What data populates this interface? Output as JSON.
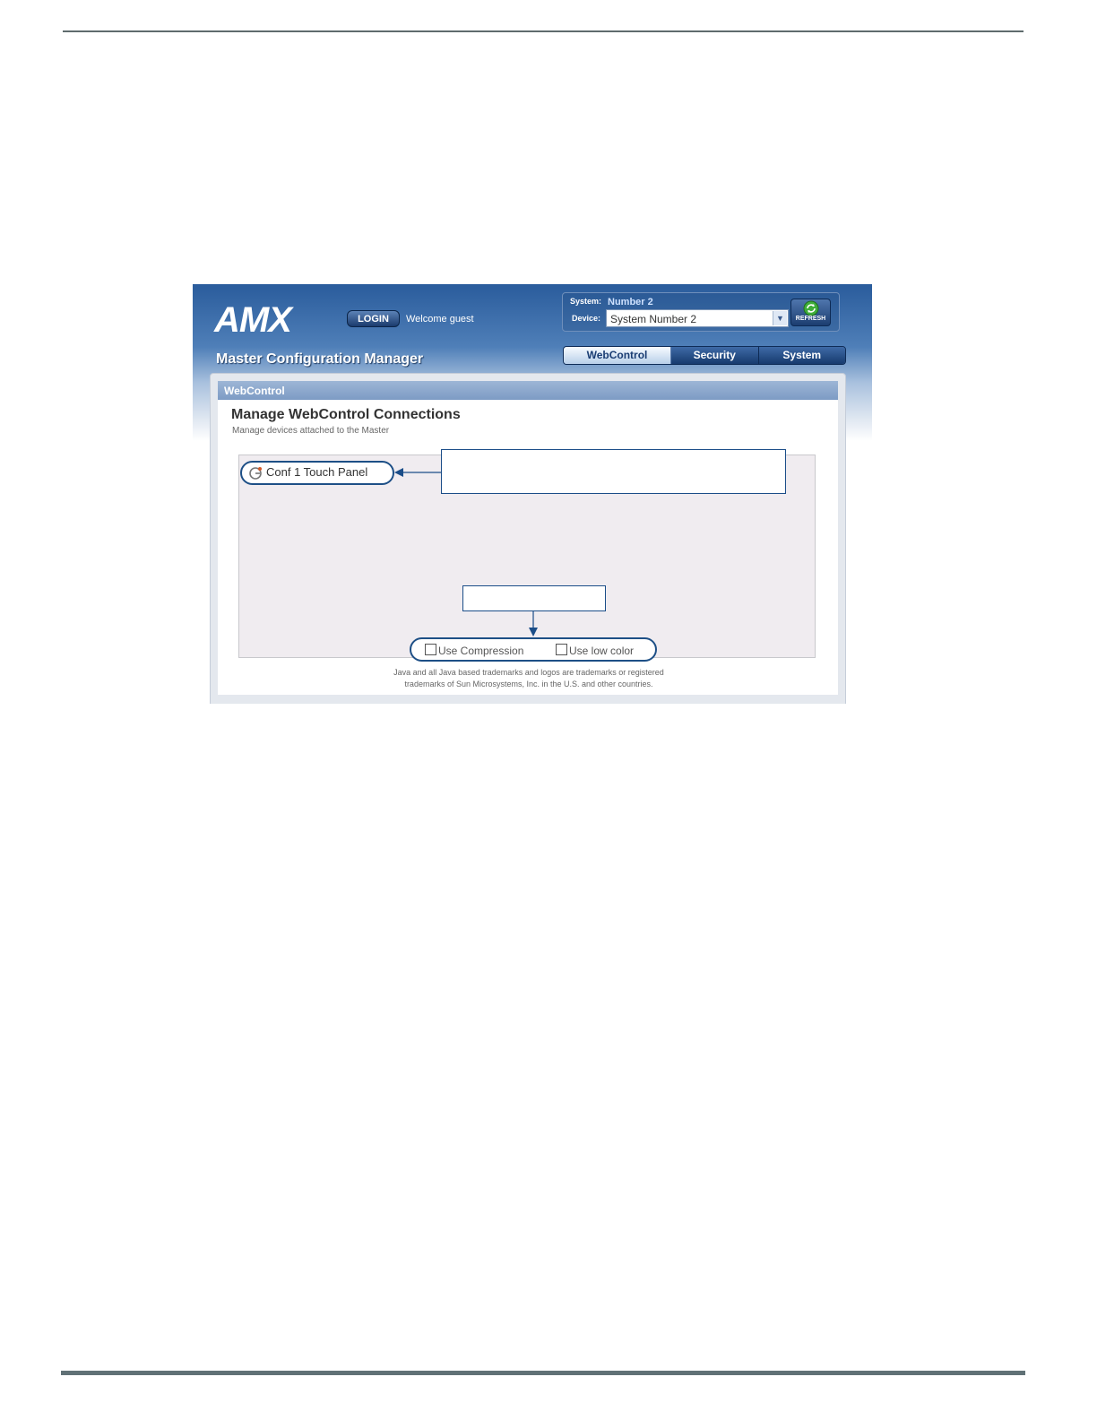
{
  "app": {
    "title": "Master Configuration Manager",
    "welcome": "Welcome guest",
    "login_label": "LOGIN",
    "logo_text": "AMX"
  },
  "system_panel": {
    "system_label": "System:",
    "system_value": "Number 2",
    "device_label": "Device:",
    "device_value": "System Number 2",
    "refresh_label": "REFRESH"
  },
  "tabs": [
    {
      "label": "WebControl",
      "active": true
    },
    {
      "label": "Security",
      "active": false
    },
    {
      "label": "System",
      "active": false
    }
  ],
  "section": {
    "title": "WebControl",
    "heading": "Manage WebControl Connections",
    "subheading": "Manage devices attached to the Master"
  },
  "devices": [
    {
      "label": "Conf 1 Touch Panel",
      "icon": "webcontrol-device-icon"
    }
  ],
  "options": {
    "compression_label": "Use Compression",
    "compression_checked": false,
    "low_color_label": "Use low color",
    "low_color_checked": false
  },
  "footer": {
    "trademark_line1": "Java and all Java based trademarks and logos are trademarks or registered",
    "trademark_line2": "trademarks of Sun Microsystems, Inc. in the U.S. and other countries."
  },
  "colors": {
    "header_blue": "#2a5c9c",
    "callout_blue": "#1d4f86",
    "page_rule": "#5f6b6d"
  }
}
